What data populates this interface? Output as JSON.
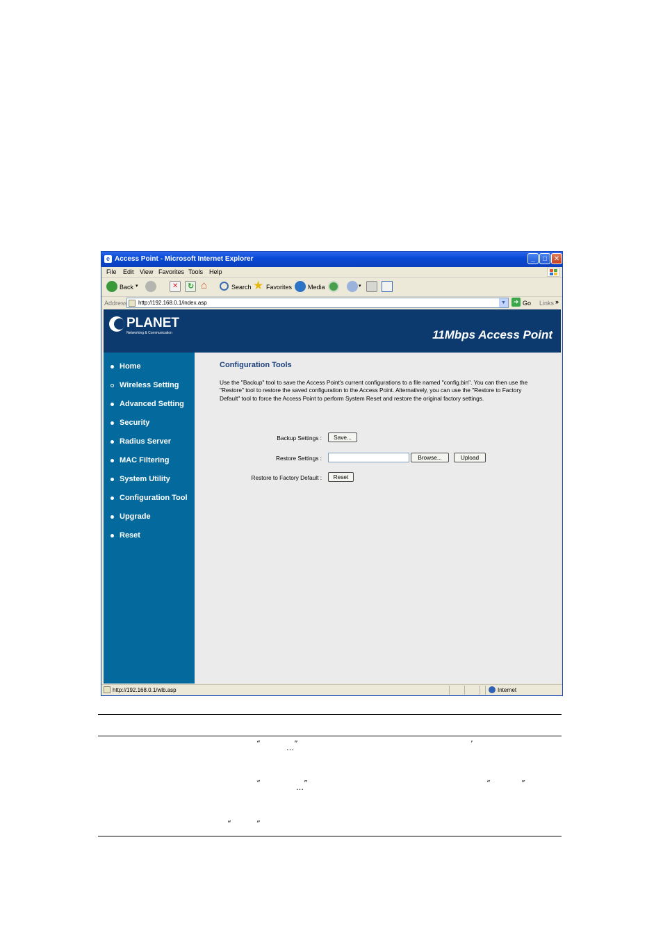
{
  "window": {
    "title": "Access Point - Microsoft Internet Explorer",
    "controls": {
      "minimize": "_",
      "maximize": "□",
      "close": "✕"
    }
  },
  "menubar": [
    "File",
    "Edit",
    "View",
    "Favorites",
    "Tools",
    "Help"
  ],
  "toolbar": {
    "back": "Back",
    "search": "Search",
    "favorites": "Favorites",
    "media": "Media"
  },
  "addressbar": {
    "label": "Address",
    "url": "http://192.168.0.1/index.asp",
    "go": "Go",
    "links": "Links"
  },
  "banner": {
    "logo": "PLANET",
    "tagline": "Networking & Communication",
    "product": "11Mbps Access Point"
  },
  "sidebar": {
    "items": [
      "Home",
      "Wireless Setting",
      "Advanced Setting",
      "Security",
      "Radius Server",
      "MAC Filtering",
      "System Utility",
      "Configuration Tool",
      "Upgrade",
      "Reset"
    ]
  },
  "main": {
    "title": "Configuration Tools",
    "description": "Use the \"Backup\" tool to save the Access Point's current configurations to a file named \"config.bin\". You can then use the \"Restore\" tool to restore the saved configuration to the Access Point. Alternatively, you can use the \"Restore to Factory Default\" tool to force the Access Point to perform System Reset and restore the original factory settings.",
    "backup": {
      "label": "Backup Settings :",
      "button": "Save..."
    },
    "restore": {
      "label": "Restore Settings :",
      "browse": "Browse...",
      "upload": "Upload"
    },
    "factory": {
      "label": "Restore to Factory Default :",
      "button": "Reset"
    }
  },
  "statusbar": {
    "text": "http://192.168.0.1/wlb.asp",
    "zone": "Internet"
  },
  "document_marks": {
    "open_quote": "“",
    "close_quote": "”",
    "apostrophe": "’",
    "ellipsis": "…"
  }
}
